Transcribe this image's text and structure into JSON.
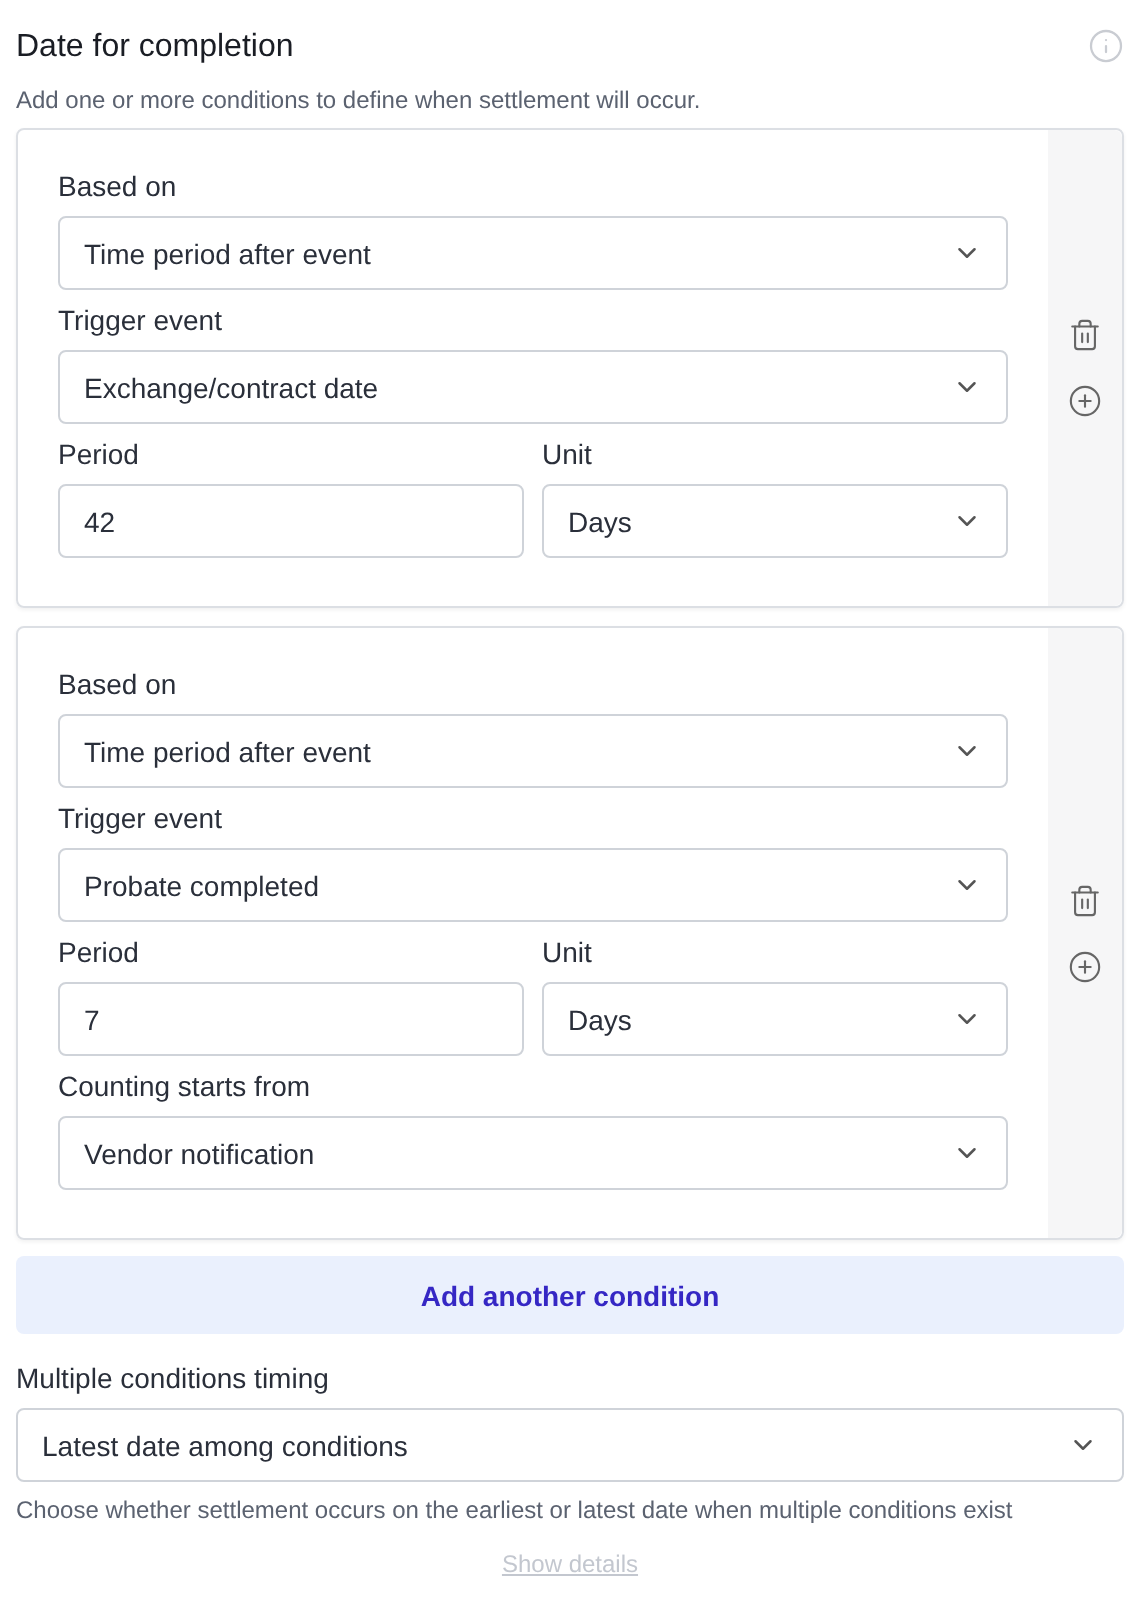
{
  "header": {
    "title": "Date for completion",
    "subtitle": "Add one or more conditions to define when settlement will occur."
  },
  "conditions": [
    {
      "rows": [
        [
          {
            "label": "Based on",
            "kind": "select",
            "value": "Time period after event"
          }
        ],
        [
          {
            "label": "Trigger event",
            "kind": "select",
            "value": "Exchange/contract date"
          }
        ],
        [
          {
            "label": "Period",
            "kind": "input",
            "value": "42"
          },
          {
            "label": "Unit",
            "kind": "select",
            "value": "Days"
          }
        ]
      ]
    },
    {
      "rows": [
        [
          {
            "label": "Based on",
            "kind": "select",
            "value": "Time period after event"
          }
        ],
        [
          {
            "label": "Trigger event",
            "kind": "select",
            "value": "Probate completed"
          }
        ],
        [
          {
            "label": "Period",
            "kind": "input",
            "value": "7"
          },
          {
            "label": "Unit",
            "kind": "select",
            "value": "Days"
          }
        ],
        [
          {
            "label": "Counting starts from",
            "kind": "select",
            "value": "Vendor notification"
          }
        ]
      ]
    }
  ],
  "add_button": "Add another condition",
  "timing": {
    "label": "Multiple conditions timing",
    "value": "Latest date among conditions",
    "help": "Choose whether settlement occurs on the earliest or latest date when multiple conditions exist"
  },
  "show_details": "Show details"
}
